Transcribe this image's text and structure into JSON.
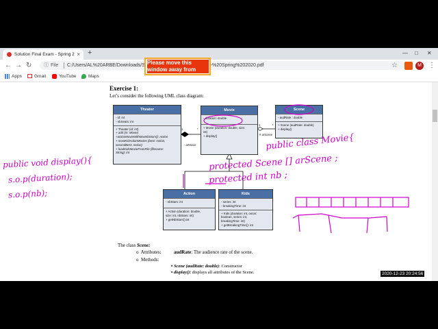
{
  "browser": {
    "tab_title": "Solution Final Exam - Spring 202...",
    "tab_close": "×",
    "new_tab": "+",
    "url_scheme_label": "File",
    "url": "C:/Users/AL%20ARBE/Downloads/Solution%20Final%20Exam%20-%20Spring%202020.pdf",
    "profile_initial": "M",
    "bookmarks": [
      {
        "label": "Apps",
        "color": "#4285f4"
      },
      {
        "label": "Gmail",
        "color": "#d93025"
      },
      {
        "label": "YouTube",
        "color": "#ff0000"
      },
      {
        "label": "Maps",
        "color": "#34a853"
      }
    ]
  },
  "banner": {
    "text": "Please move this window away from"
  },
  "document": {
    "heading": "Exercise 1:",
    "intro": "Let’s consider the following UML class diagram:",
    "classes": {
      "theater": {
        "name": "Theater",
        "attributes": [
          "- id: int",
          "- nbSeats: int"
        ],
        "methods": [
          "+ Theater (id: int)",
          "+ add (m: Movie)",
          "+actionMovieWithMaxNbStars(): Action",
          "+ mostKidActionMovies (best: Action,",
          "secondBest: Action)",
          "+ loadKidsMovieFromFile (filename:",
          "String): int"
        ]
      },
      "movie": {
        "name": "Movie",
        "attributes": [
          "- duration: double"
        ],
        "methods": [
          "+ Movie (duration: double, size:",
          "int)",
          "+ display()"
        ]
      },
      "scene": {
        "name": "Scene",
        "attributes": [
          "- audRate : double"
        ],
        "methods": [
          "+ Scene (audRate: double)",
          "+ display()"
        ]
      },
      "action": {
        "name": "Action",
        "attributes": [
          "- nbStars: int"
        ],
        "methods": [
          "+ Action (duration: double,",
          "size: int, nbStars: int)",
          "+ getNbStars():int"
        ]
      },
      "kids": {
        "name": "Kids",
        "attributes": [
          "- series: int",
          "- breakingTime: int"
        ],
        "methods": [
          "+ Kids (duration: int, oscar:",
          "boolean, series: int,",
          "breakingTime: int)",
          "+ getBreakingTime(): int"
        ]
      }
    },
    "multiplicities": {
      "theater_movie_one": "1",
      "theater_movie_many": "*",
      "movie_scene_one": "1",
      "movie_scene_many": "*"
    },
    "roles": {
      "movie_role": "- arMovie",
      "scene_role": "# arScene"
    },
    "scene_desc": {
      "class_label": "The class",
      "class_name": "Scene:",
      "bullet": "o",
      "attributes_label": "Attributes:",
      "attr_name": "audRate",
      "attr_desc": ": The audience rate of the scene.",
      "methods_label": "Methods:",
      "method1_sig": "Scene (audRate: double)",
      "method1_desc": ": Constructor",
      "method2_sig": "display():",
      "method2_desc": "displays all attributes of the Scene."
    }
  },
  "handwriting": {
    "code_right_1": "public class Movie{",
    "code_right_2": "protected Scene [] arScene ;",
    "code_right_3": "protected int nb ;",
    "code_left_1": "public void display(){",
    "code_left_2": "s.o.p(duration);",
    "code_left_3": "s.o.p(nb);",
    "ink_color": "#d000c8"
  },
  "overlay": {
    "timestamp": "2020-12-23 20:24:56"
  }
}
